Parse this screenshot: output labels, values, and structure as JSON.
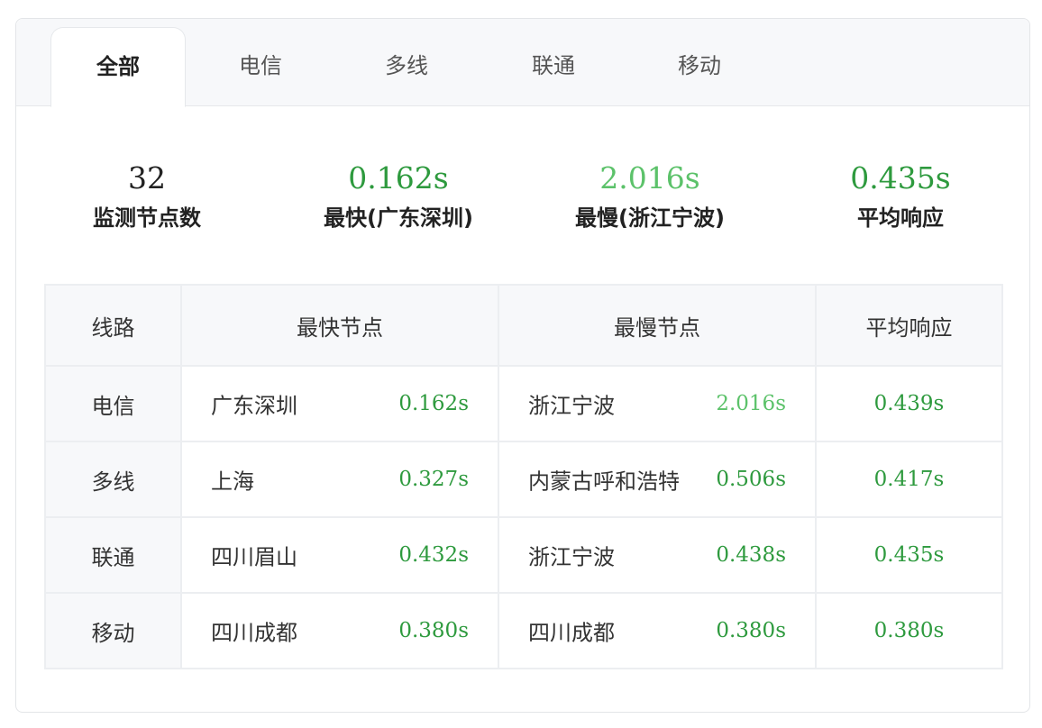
{
  "tabs": [
    {
      "label": "全部",
      "active": true
    },
    {
      "label": "电信",
      "active": false
    },
    {
      "label": "多线",
      "active": false
    },
    {
      "label": "联通",
      "active": false
    },
    {
      "label": "移动",
      "active": false
    }
  ],
  "stats": [
    {
      "value": "32",
      "label": "监测节点数",
      "color": "#222222"
    },
    {
      "value": "0.162s",
      "label": "最快(广东深圳)",
      "color": "#2e9a3e"
    },
    {
      "value": "2.016s",
      "label": "最慢(浙江宁波)",
      "color": "#5cc26a"
    },
    {
      "value": "0.435s",
      "label": "平均响应",
      "color": "#2e9a3e"
    }
  ],
  "table": {
    "headers": [
      "线路",
      "最快节点",
      "最慢节点",
      "平均响应"
    ],
    "rows": [
      {
        "line": "电信",
        "fast_node": "广东深圳",
        "fast_time": "0.162s",
        "slow_node": "浙江宁波",
        "slow_time": "2.016s",
        "avg": "0.439s"
      },
      {
        "line": "多线",
        "fast_node": "上海",
        "fast_time": "0.327s",
        "slow_node": "内蒙古呼和浩特",
        "slow_time": "0.506s",
        "avg": "0.417s"
      },
      {
        "line": "联通",
        "fast_node": "四川眉山",
        "fast_time": "0.432s",
        "slow_node": "浙江宁波",
        "slow_time": "0.438s",
        "avg": "0.435s"
      },
      {
        "line": "移动",
        "fast_node": "四川成都",
        "fast_time": "0.380s",
        "slow_node": "四川成都",
        "slow_time": "0.380s",
        "avg": "0.380s"
      }
    ]
  },
  "colors": {
    "green": "#2e9a3e",
    "light_green": "#5cc26a"
  }
}
